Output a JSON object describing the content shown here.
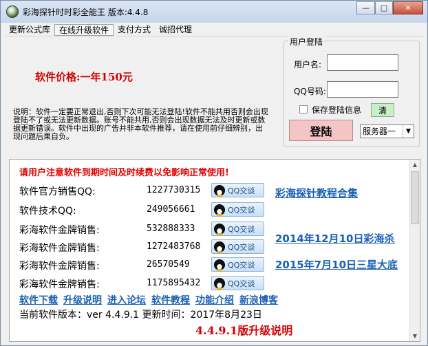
{
  "window": {
    "title": "彩海探针时时彩全能王 版本:4.4.8",
    "minimize": "—",
    "maximize": "□",
    "close": "✕"
  },
  "menu": {
    "items": [
      "更新公式库",
      "在线升级软件",
      "支付方式",
      "诚招代理"
    ]
  },
  "top": {
    "price": "软件价格:一年150元",
    "notice": "说明：软件一定要正常退出,否则下次可能无法登陆!软件不能共用否则会出现登陆不了或无法更新数据。账号不能共用,否则会出现数据无法及时更新或数据更新错误。软件中出现的广告并非本软件推荐，请在使用前仔细辨别，出现问题后果自负。"
  },
  "login": {
    "legend": "用户登陆",
    "username_label": "用户名:",
    "qq_label": "QQ号码:",
    "save_label": "保存登陆信息",
    "clear_label": "清",
    "login_label": "登陆",
    "server_value": "服务器一"
  },
  "content": {
    "warning": "请用户注意软件到期时间及时续费以免影响正常使用!",
    "rows": [
      {
        "label": "软件官方销售QQ:",
        "qq": "1227730315",
        "button": "QQ交谈"
      },
      {
        "label": "软件技术QQ:",
        "qq": "249056661",
        "button": "QQ交谈"
      },
      {
        "label": "彩海软件金牌销售:",
        "qq": "532888333",
        "button": "QQ交谈"
      },
      {
        "label": "彩海软件金牌销售:",
        "qq": "1272483768",
        "button": "QQ交谈"
      },
      {
        "label": "彩海软件金牌销售:",
        "qq": "26570549",
        "button": "QQ交谈"
      },
      {
        "label": "彩海软件金牌销售:",
        "qq": "1175895432",
        "button": "QQ交谈"
      }
    ],
    "side_links": [
      "彩海探针教程合集",
      "2014年12月10日彩海杀",
      "2015年7月10日三星大底"
    ],
    "links": [
      "软件下载",
      "升级说明",
      "进入论坛",
      "软件教程",
      "功能介绍",
      "新浪博客"
    ],
    "version_line": "当前软件版本：ver 4.4.9.1 更新时间：2017年8月23日",
    "cut_text": "4.4.9.1版升级说明"
  }
}
